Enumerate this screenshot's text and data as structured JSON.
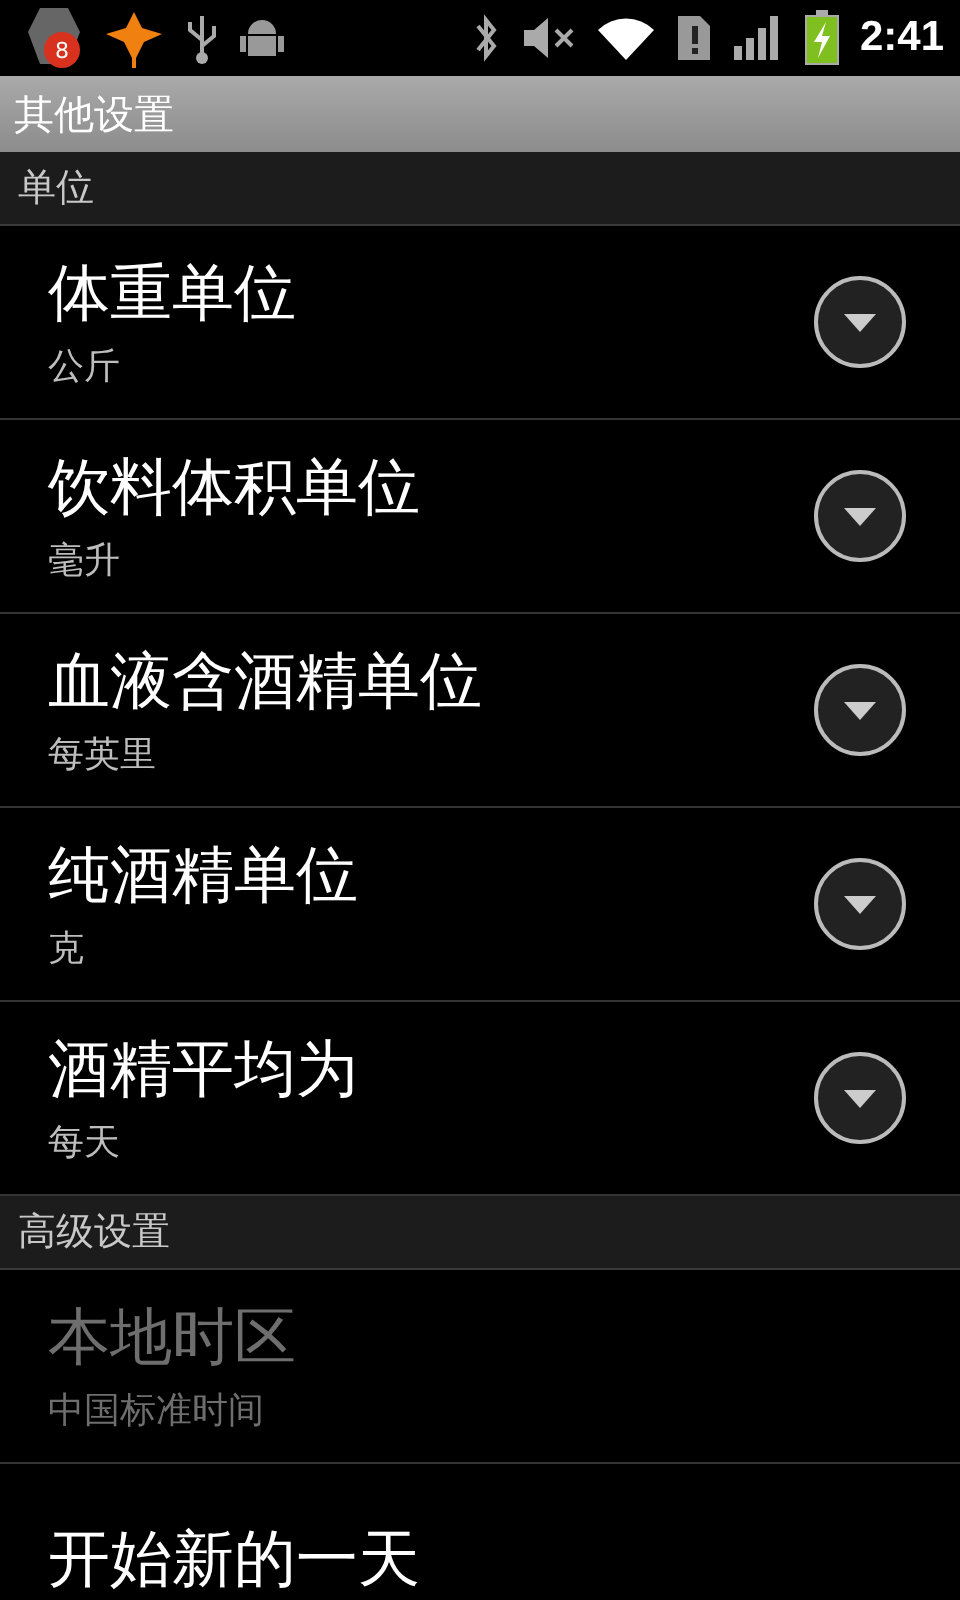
{
  "status_bar": {
    "notification_count": "8",
    "time": "2:41"
  },
  "title_bar": {
    "title": "其他设置"
  },
  "sections": [
    {
      "header": "单位",
      "items": [
        {
          "kind": "dropdown",
          "title": "体重单位",
          "summary": "公斤",
          "disabled": false
        },
        {
          "kind": "dropdown",
          "title": "饮料体积单位",
          "summary": "毫升",
          "disabled": false
        },
        {
          "kind": "dropdown",
          "title": "血液含酒精单位",
          "summary": "每英里",
          "disabled": false
        },
        {
          "kind": "dropdown",
          "title": "纯酒精单位",
          "summary": "克",
          "disabled": false
        },
        {
          "kind": "dropdown",
          "title": "酒精平均为",
          "summary": "每天",
          "disabled": false
        }
      ]
    },
    {
      "header": "高级设置",
      "items": [
        {
          "kind": "plain",
          "title": "本地时区",
          "summary": "中国标准时间",
          "disabled": true
        },
        {
          "kind": "plain",
          "title": "开始新的一天",
          "disabled": false
        }
      ]
    }
  ]
}
